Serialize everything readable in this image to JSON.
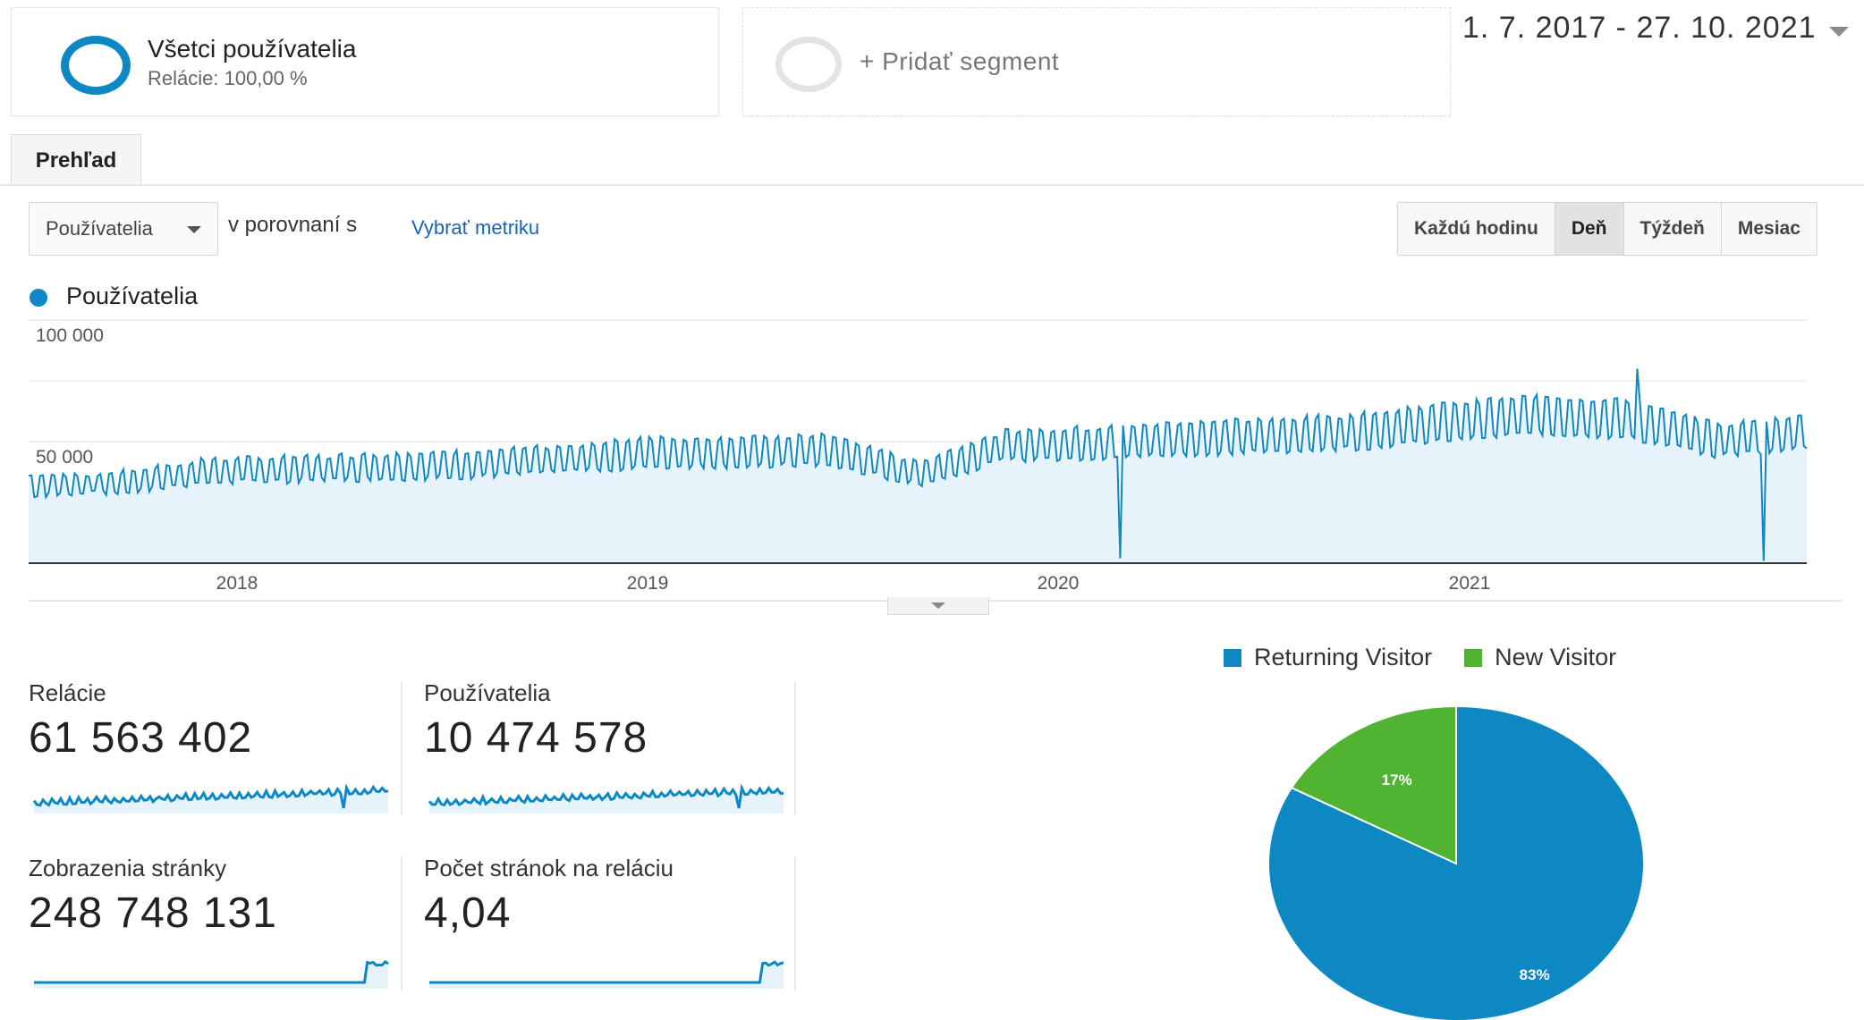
{
  "segments": {
    "all_users": {
      "title": "Všetci používatelia",
      "subtitle": "Relácie: 100,00 %"
    },
    "add_label": "+ Pridať segment"
  },
  "date_range": "1. 7. 2017 - 27. 10. 2021",
  "tabs": [
    {
      "label": "Prehľad",
      "active": true
    }
  ],
  "controls": {
    "metric_selected": "Používatelia",
    "compare_text": "v porovnaní s",
    "pick_metric_link": "Vybrať metriku",
    "time_buttons": [
      {
        "label": "Každú hodinu",
        "active": false
      },
      {
        "label": "Deň",
        "active": true
      },
      {
        "label": "Týždeň",
        "active": false
      },
      {
        "label": "Mesiac",
        "active": false
      }
    ]
  },
  "colors": {
    "accent": "#0d88c2",
    "fill": "#e6f3fa",
    "new_visitor": "#50b432",
    "link": "#1a63b8"
  },
  "chart_data": [
    {
      "type": "area",
      "series": [
        {
          "name": "Používatelia",
          "x": [
            "2017-07",
            "2017-10",
            "2018-01",
            "2018-04",
            "2018-07",
            "2018-10",
            "2019-01",
            "2019-04",
            "2019-07",
            "2019-10",
            "2019-12",
            "2020-01",
            "2020-04",
            "2020-07",
            "2020-10",
            "2021-01",
            "2021-03",
            "2021-04",
            "2021-07",
            "2021-09",
            "2021-10"
          ],
          "values": [
            33000,
            34000,
            39000,
            40000,
            41000,
            42000,
            44000,
            47000,
            47000,
            48000,
            38000,
            50000,
            51000,
            53000,
            54000,
            56000,
            60000,
            63000,
            61000,
            52000,
            56000
          ]
        }
      ],
      "yticks": [
        "100 000",
        "50 000"
      ],
      "ylim": [
        0,
        100000
      ],
      "xticks": [
        "2018",
        "2019",
        "2020",
        "2021"
      ],
      "legend": "top-left",
      "grid": true
    },
    {
      "type": "pie",
      "categories": [
        "Returning Visitor",
        "New Visitor"
      ],
      "values": [
        83,
        17
      ],
      "labels": [
        "83%",
        "17%"
      ],
      "colors": [
        "#0d88c2",
        "#50b432"
      ],
      "legend": "top"
    }
  ],
  "metrics": [
    {
      "label": "Relácie",
      "value": "61 563 402",
      "spark": "trend"
    },
    {
      "label": "Používatelia",
      "value": "10 474 578",
      "spark": "trend"
    },
    {
      "label": "Zobrazenia stránky",
      "value": "248 748 131",
      "spark": "step"
    },
    {
      "label": "Počet stránok na reláciu",
      "value": "4,04",
      "spark": "step"
    }
  ]
}
